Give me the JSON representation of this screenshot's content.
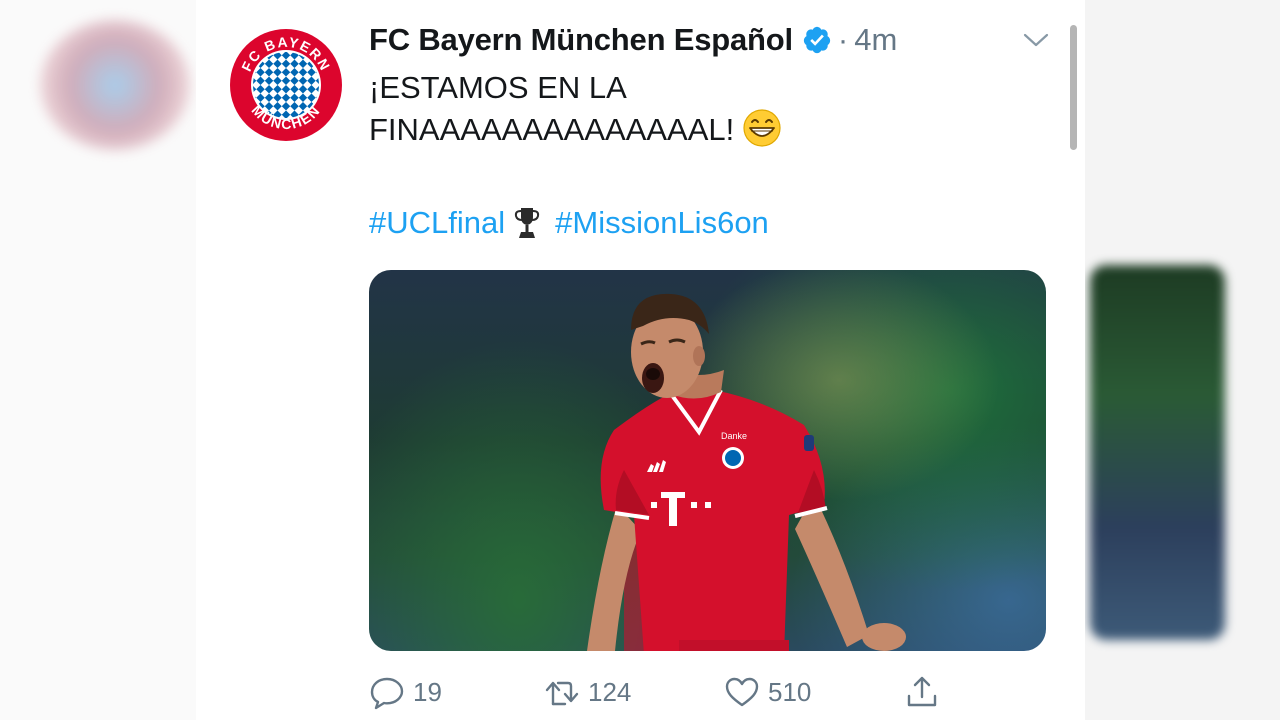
{
  "tweet": {
    "author_name": "FC Bayern München Español",
    "separator": "·",
    "time": "4m",
    "text_line1": "¡ESTAMOS EN LA",
    "text_line2": "FINAAAAAAAAAAAAAAL!",
    "hashtag1": "#UCLfinal",
    "hashtag2": "#MissionLis6on",
    "avatar_text_top": "FC BAYERN",
    "avatar_text_bottom": "MÜNCHEN",
    "jersey_text": "Danke"
  },
  "actions": {
    "replies": "19",
    "retweets": "124",
    "likes": "510"
  },
  "colors": {
    "link": "#1da1f2",
    "muted": "#657786",
    "bayern_red": "#dc052d",
    "bayern_blue": "#0066b2"
  },
  "icons": [
    "verified-badge-icon",
    "chevron-down-icon",
    "trophy-icon",
    "grinning-emoji-icon",
    "reply-icon",
    "retweet-icon",
    "like-icon",
    "share-icon"
  ]
}
